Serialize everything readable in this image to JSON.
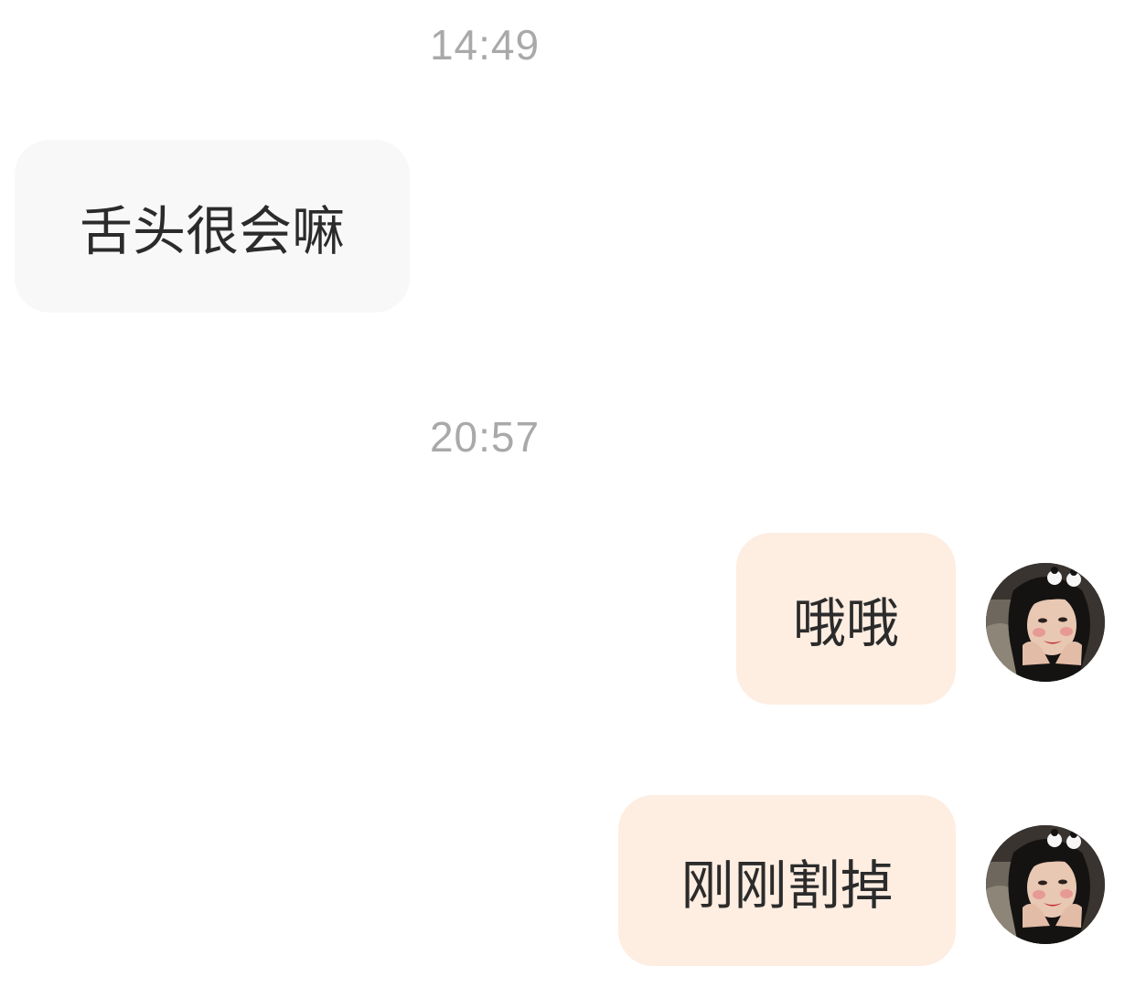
{
  "chat": {
    "messages": [
      {
        "timestamp": "14:49",
        "side": "received",
        "text": "舌头很会嘛"
      },
      {
        "timestamp": "20:57",
        "side": "sent",
        "text": "哦哦"
      },
      {
        "side": "sent",
        "text": "刚刚割掉"
      }
    ]
  },
  "colors": {
    "received_bubble": "#f8f8f8",
    "sent_bubble": "#feede1",
    "timestamp_text": "#a9a9a9",
    "message_text": "#2b2b2b"
  },
  "icons": {
    "avatar": "user-avatar-photo"
  }
}
